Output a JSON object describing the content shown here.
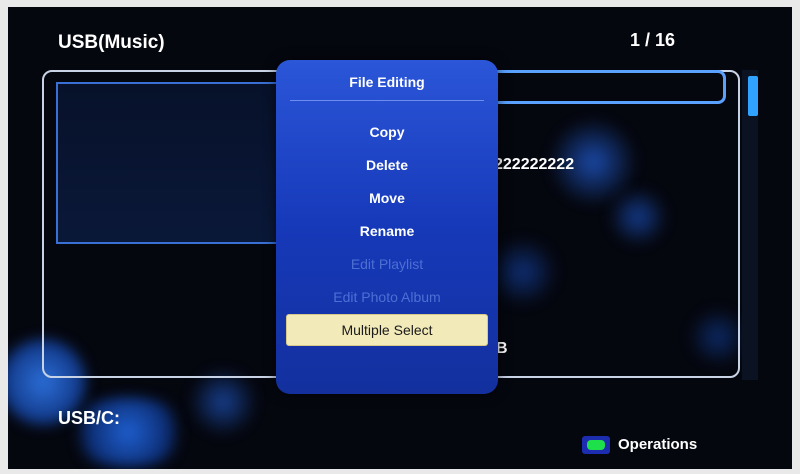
{
  "header": {
    "title": "USB(Music)",
    "page_indicator": "1 / 16"
  },
  "list": {
    "row_texts": [
      "222222222",
      "B"
    ]
  },
  "popup": {
    "title": "File Editing",
    "items": [
      {
        "label": "Copy",
        "state": "enabled"
      },
      {
        "label": "Delete",
        "state": "enabled"
      },
      {
        "label": "Move",
        "state": "enabled"
      },
      {
        "label": "Rename",
        "state": "enabled"
      },
      {
        "label": "Edit Playlist",
        "state": "disabled"
      },
      {
        "label": "Edit Photo Album",
        "state": "disabled"
      },
      {
        "label": "Multiple Select",
        "state": "selected"
      }
    ]
  },
  "footer": {
    "path": "USB/C:",
    "operations_label": "Operations",
    "operations_key_color": "#1ee04a"
  },
  "colors": {
    "popup_bg": "#1639b9",
    "selection_highlight": "#f3eab9",
    "scrollbar_thumb": "#2fa3ff",
    "list_selection_border": "#5aa0ff"
  }
}
